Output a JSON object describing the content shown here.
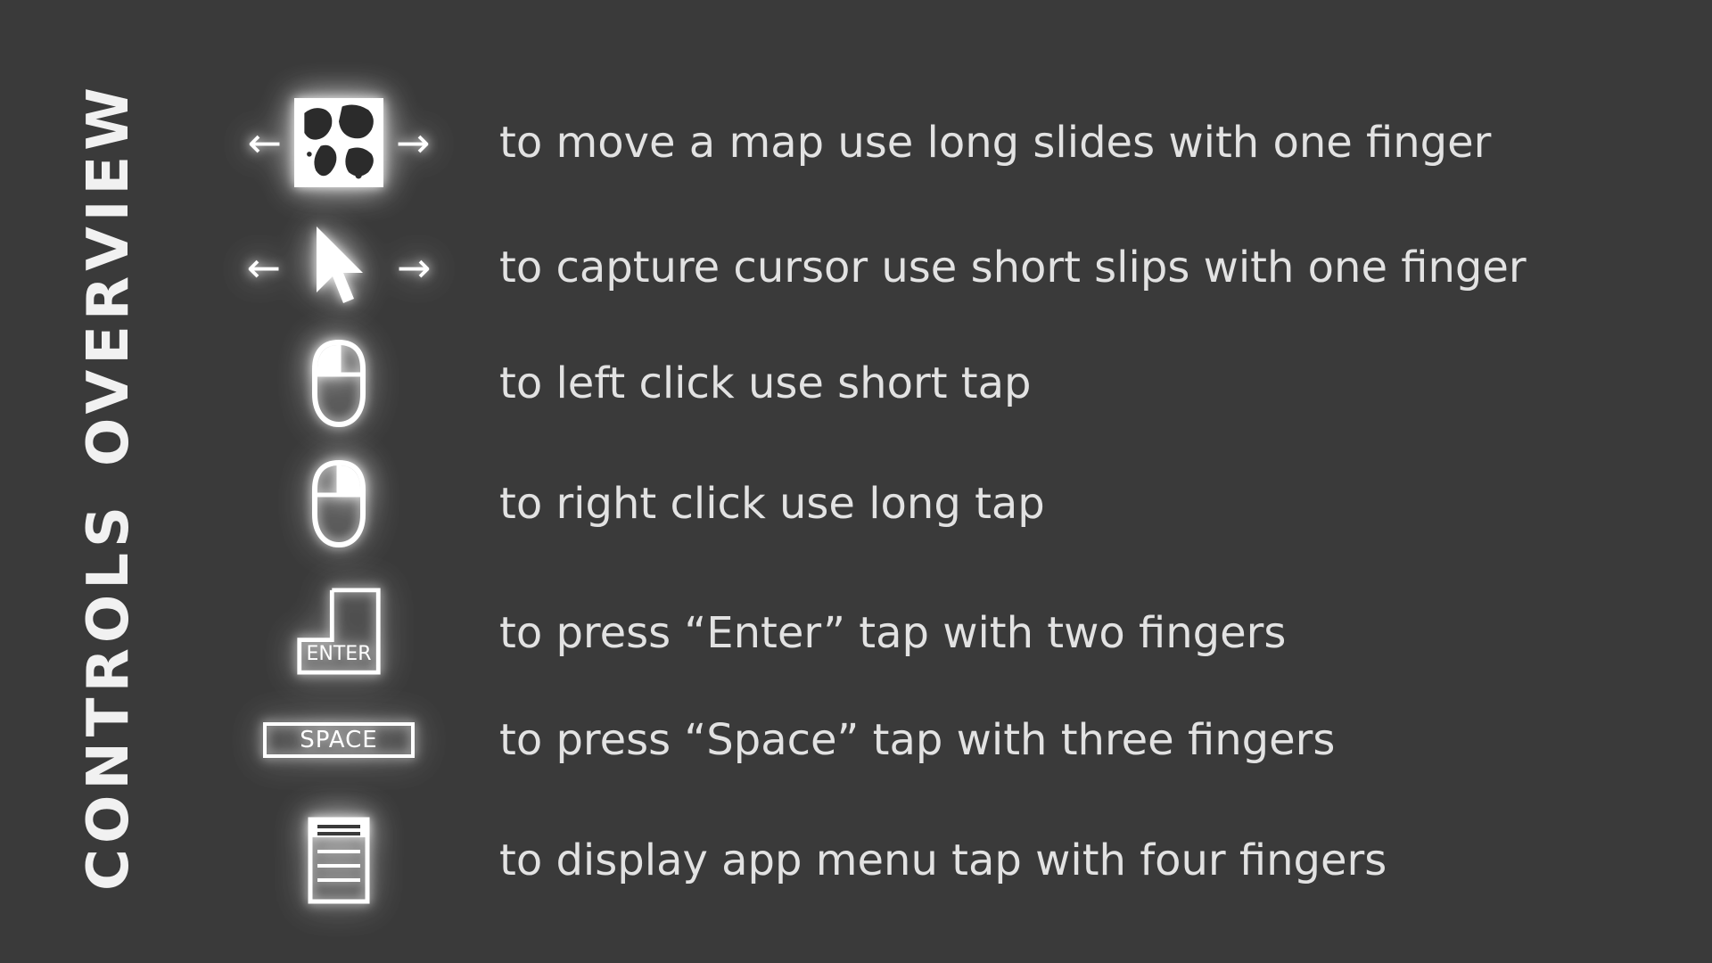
{
  "headings": {
    "overview": "OVERVIEW",
    "controls": "CONTROLS"
  },
  "rows": {
    "map": {
      "text": "to move a map use long slides with one finger"
    },
    "cursor": {
      "text": "to capture cursor use short slips with one finger"
    },
    "lclick": {
      "text": "to left click use short tap"
    },
    "rclick": {
      "text": "to right click use long tap"
    },
    "enter": {
      "text": "to press “Enter” tap with two fingers",
      "key_label": "ENTER"
    },
    "space": {
      "text": "to press “Space” tap with three fingers",
      "key_label": "SPACE"
    },
    "menu": {
      "text": "to display app menu tap with four fingers"
    }
  },
  "glyphs": {
    "arrow_left": "←",
    "arrow_right": "→"
  }
}
